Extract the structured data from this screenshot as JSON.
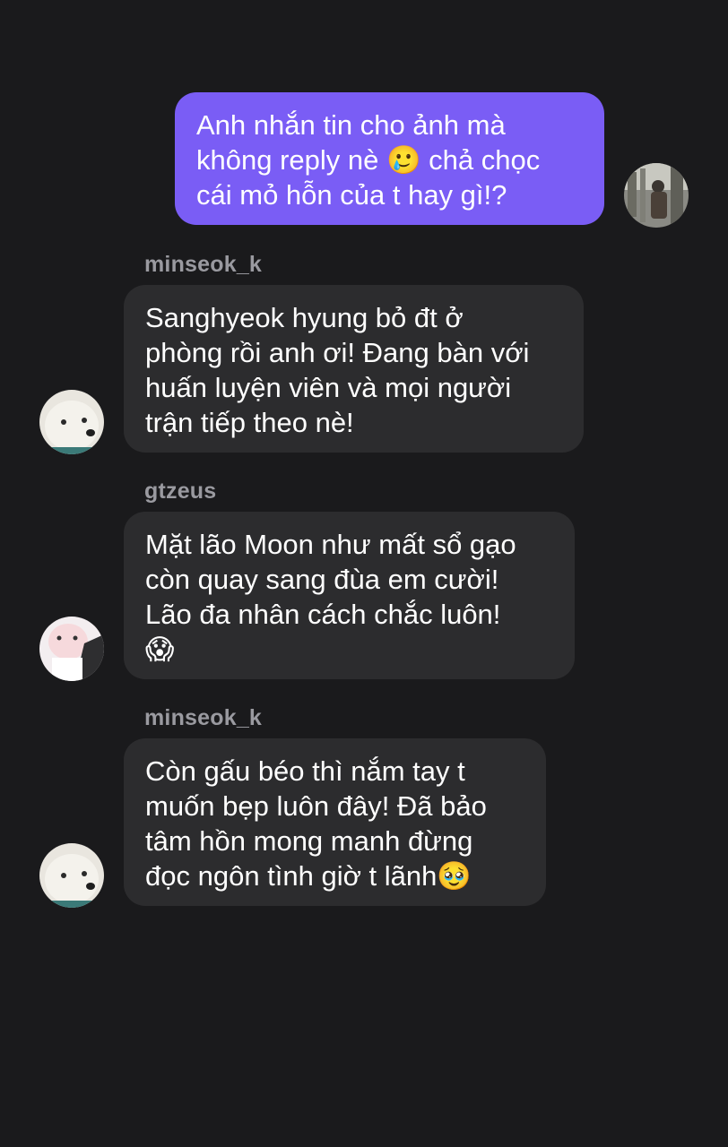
{
  "messages": [
    {
      "direction": "outgoing",
      "text": "Anh nhắn tin cho ảnh mà\nkhông reply nè 🥲 chả chọc\ncái mỏ hỗn của t hay gì!?"
    },
    {
      "direction": "incoming",
      "sender": "minseok_k",
      "text": "Sanghyeok hyung bỏ đt ở\nphòng rồi anh ơi! Đang bàn với\nhuấn luyện viên và mọi người\ntrận tiếp theo nè!"
    },
    {
      "direction": "incoming",
      "sender": "gtzeus",
      "text": "Mặt lão Moon như mất sổ gạo\ncòn quay sang đùa em cười!\nLão đa nhân cách chắc luôn!\n😱"
    },
    {
      "direction": "incoming",
      "sender": "minseok_k",
      "text": "Còn gấu béo thì nắm tay t\nmuốn bẹp luôn đây! Đã bảo\ntâm hồn mong manh đừng\nđọc ngôn tình giờ t lãnh🥹"
    }
  ],
  "colors": {
    "background": "#1a1a1c",
    "outgoing_bubble": "#7a5df5",
    "incoming_bubble": "#2c2c2e",
    "sender_name": "#9a9aa0"
  }
}
